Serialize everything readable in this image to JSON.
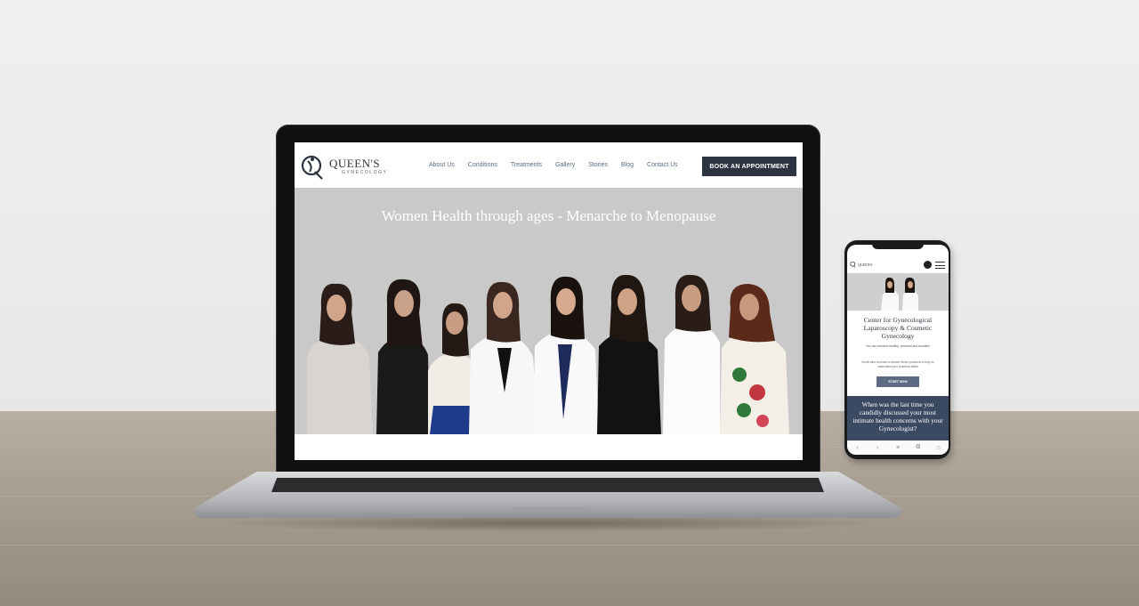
{
  "laptop_site": {
    "logo": {
      "name": "QUEEN'S",
      "subtitle": "GYNECOLOGY"
    },
    "nav": [
      "About Us",
      "Conditions",
      "Treatments",
      "Gallery",
      "Stories",
      "Blog",
      "Contact Us"
    ],
    "cta": "BOOK AN APPOINTMENT",
    "hero_title": "Women Health through ages - Menarche to Menopause",
    "hero_colors": {
      "background": "#c9c9c9",
      "brand_dark": "#2d3441",
      "nav_link": "#5a6b86"
    }
  },
  "phone_site": {
    "logo_name": "QUEEN'S",
    "title": "Center for Gynecological Laparoscopy & Cosmetic Gynecology",
    "subtitle": "You can become healthy, powerful and beautiful",
    "prompt_text": "Kindly take a minute to answer these questions to help us understand your problems better",
    "cta": "START NOW",
    "question": "When was the last time you candidly discussed your most intimate health concerns with your Gynecologist?",
    "bottom_bar_icons": [
      "back-icon",
      "forward-icon",
      "menu-icon",
      "tabs-icon",
      "home-icon"
    ],
    "accent_color": "#3b4a63"
  }
}
